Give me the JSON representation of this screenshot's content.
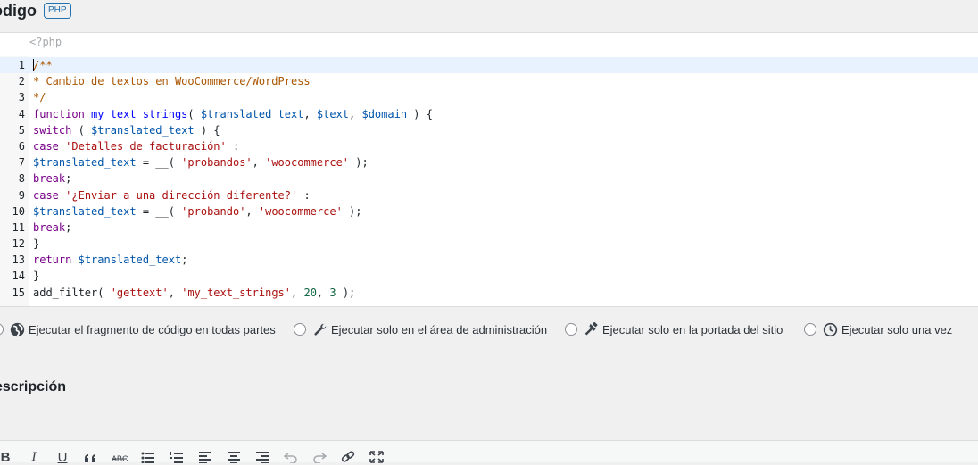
{
  "code_section": {
    "title": "ódigo",
    "language_badge": "PHP",
    "opening_tag": "<?php",
    "lines": [
      {
        "number": "1",
        "tokens": [
          {
            "t": "/**",
            "c": "comment"
          }
        ]
      },
      {
        "number": "2",
        "tokens": [
          {
            "t": "* Cambio de textos en WooCommerce/WordPress",
            "c": "comment"
          }
        ]
      },
      {
        "number": "3",
        "tokens": [
          {
            "t": "*/",
            "c": "comment"
          }
        ]
      },
      {
        "number": "4",
        "tokens": [
          {
            "t": "function",
            "c": "keyword"
          },
          {
            "t": " ",
            "c": "punct"
          },
          {
            "t": "my_text_strings",
            "c": "def"
          },
          {
            "t": "( ",
            "c": "punct"
          },
          {
            "t": "$translated_text",
            "c": "variable"
          },
          {
            "t": ", ",
            "c": "punct"
          },
          {
            "t": "$text",
            "c": "variable"
          },
          {
            "t": ", ",
            "c": "punct"
          },
          {
            "t": "$domain",
            "c": "variable"
          },
          {
            "t": " ) {",
            "c": "punct"
          }
        ]
      },
      {
        "number": "5",
        "tokens": [
          {
            "t": "switch",
            "c": "keyword"
          },
          {
            "t": " ( ",
            "c": "punct"
          },
          {
            "t": "$translated_text",
            "c": "variable"
          },
          {
            "t": " ) {",
            "c": "punct"
          }
        ]
      },
      {
        "number": "6",
        "tokens": [
          {
            "t": "case",
            "c": "keyword"
          },
          {
            "t": " ",
            "c": "punct"
          },
          {
            "t": "'Detalles de facturación'",
            "c": "string"
          },
          {
            "t": " :",
            "c": "punct"
          }
        ]
      },
      {
        "number": "7",
        "tokens": [
          {
            "t": "$translated_text",
            "c": "variable"
          },
          {
            "t": " = __( ",
            "c": "punct"
          },
          {
            "t": "'probandos'",
            "c": "string"
          },
          {
            "t": ", ",
            "c": "punct"
          },
          {
            "t": "'woocommerce'",
            "c": "string"
          },
          {
            "t": " );",
            "c": "punct"
          }
        ]
      },
      {
        "number": "8",
        "tokens": [
          {
            "t": "break",
            "c": "keyword"
          },
          {
            "t": ";",
            "c": "punct"
          }
        ]
      },
      {
        "number": "9",
        "tokens": [
          {
            "t": "case",
            "c": "keyword"
          },
          {
            "t": " ",
            "c": "punct"
          },
          {
            "t": "'¿Enviar a una dirección diferente?'",
            "c": "string"
          },
          {
            "t": " :",
            "c": "punct"
          }
        ]
      },
      {
        "number": "10",
        "tokens": [
          {
            "t": "$translated_text",
            "c": "variable"
          },
          {
            "t": " = __( ",
            "c": "punct"
          },
          {
            "t": "'probando'",
            "c": "string"
          },
          {
            "t": ", ",
            "c": "punct"
          },
          {
            "t": "'woocommerce'",
            "c": "string"
          },
          {
            "t": " );",
            "c": "punct"
          }
        ]
      },
      {
        "number": "11",
        "tokens": [
          {
            "t": "break",
            "c": "keyword"
          },
          {
            "t": ";",
            "c": "punct"
          }
        ]
      },
      {
        "number": "12",
        "tokens": [
          {
            "t": "}",
            "c": "punct"
          }
        ]
      },
      {
        "number": "13",
        "tokens": [
          {
            "t": "return",
            "c": "keyword"
          },
          {
            "t": " ",
            "c": "punct"
          },
          {
            "t": "$translated_text",
            "c": "variable"
          },
          {
            "t": ";",
            "c": "punct"
          }
        ]
      },
      {
        "number": "14",
        "tokens": [
          {
            "t": "}",
            "c": "punct"
          }
        ]
      },
      {
        "number": "15",
        "tokens": [
          {
            "t": "add_filter",
            "c": "punct"
          },
          {
            "t": "( ",
            "c": "punct"
          },
          {
            "t": "'gettext'",
            "c": "string"
          },
          {
            "t": ", ",
            "c": "punct"
          },
          {
            "t": "'my_text_strings'",
            "c": "string"
          },
          {
            "t": ", ",
            "c": "punct"
          },
          {
            "t": "20",
            "c": "number"
          },
          {
            "t": ", ",
            "c": "punct"
          },
          {
            "t": "3",
            "c": "number"
          },
          {
            "t": " );",
            "c": "punct"
          }
        ]
      }
    ]
  },
  "run_options": [
    {
      "label": "Ejecutar el fragmento de código en todas partes",
      "icon": "globe-icon",
      "checked": true
    },
    {
      "label": "Ejecutar solo en el área de administración",
      "icon": "wrench-icon",
      "checked": false
    },
    {
      "label": "Ejecutar solo en la portada del sitio",
      "icon": "hammer-icon",
      "checked": false
    },
    {
      "label": "Ejecutar solo una vez",
      "icon": "clock-icon",
      "checked": false
    }
  ],
  "description_section": {
    "title": "escripción"
  },
  "editor_toolbar": {
    "bold": "B",
    "italic": "I",
    "underline": "U",
    "buttons": [
      "bold-icon",
      "italic-icon",
      "underline-icon",
      "blockquote-icon",
      "strikethrough-icon",
      "bullet-list-icon",
      "numbered-list-icon",
      "align-left-icon",
      "align-center-icon",
      "align-right-icon",
      "undo-icon",
      "redo-icon",
      "link-icon",
      "fullscreen-icon"
    ]
  },
  "colors": {
    "accent": "#2271b1",
    "active_line": "#e8f2fe",
    "comment": "#aa5500",
    "keyword": "#770088",
    "variable": "#0055aa",
    "string": "#aa1111"
  }
}
